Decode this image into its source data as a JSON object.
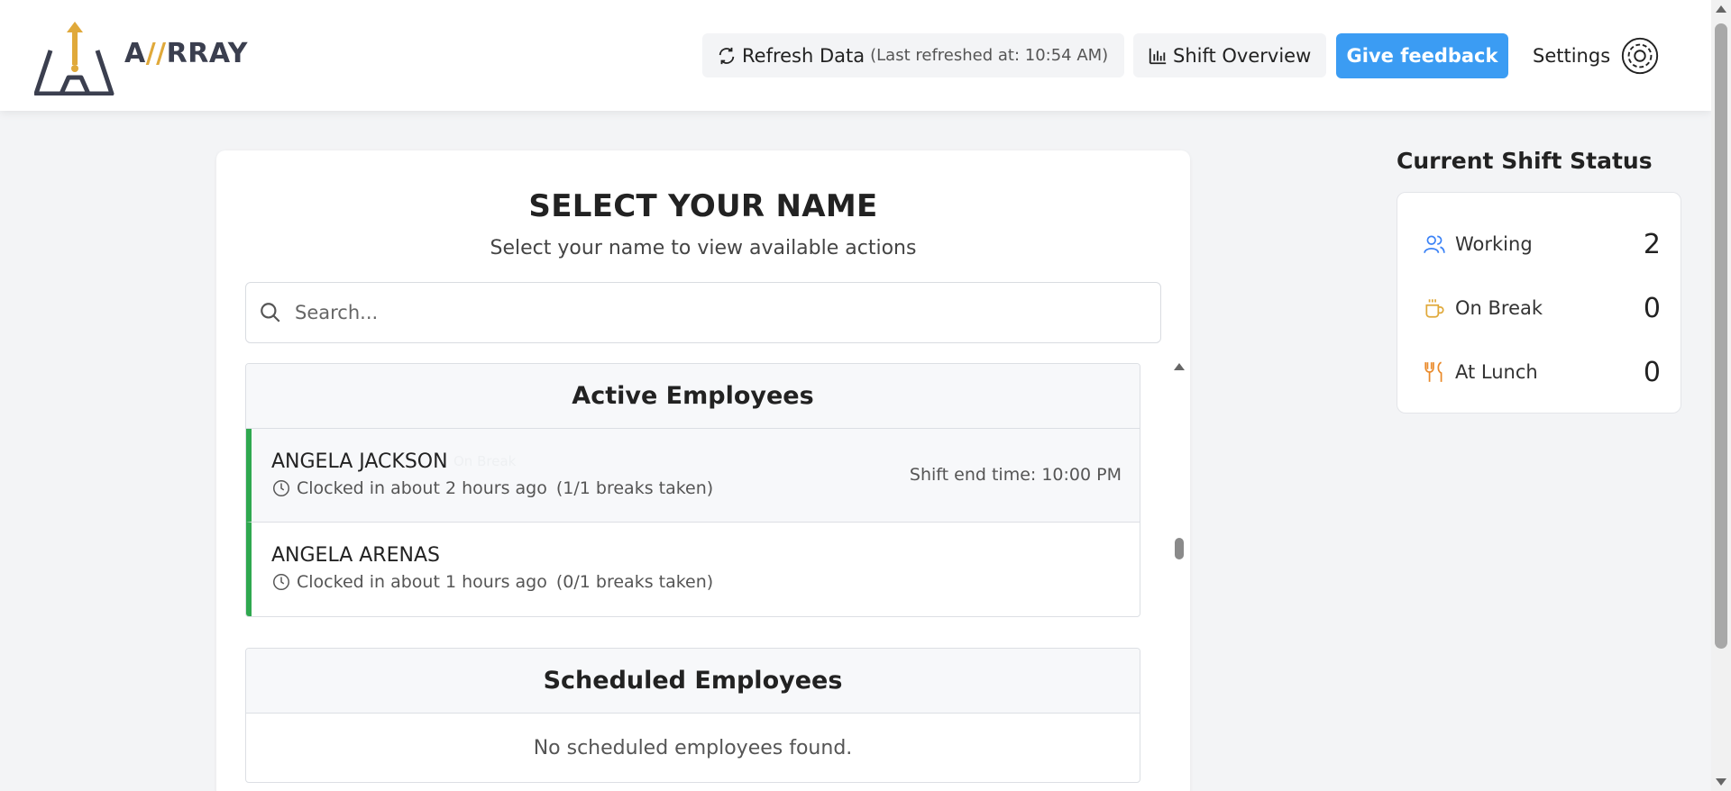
{
  "header": {
    "logo_text_a": "A",
    "logo_text_slash": "//",
    "logo_text_rest": "RRAY",
    "refresh_label": "Refresh Data",
    "refresh_sub": "(Last refreshed at: 10:54 AM)",
    "shift_overview_label": "Shift Overview",
    "feedback_label": "Give feedback",
    "settings_label": "Settings"
  },
  "main": {
    "title": "SELECT YOUR NAME",
    "subtitle": "Select your name to view available actions",
    "search_placeholder": "Search...",
    "active_section_title": "Active Employees",
    "active_employees": [
      {
        "name": "ANGELA JACKSON",
        "badge": "On Break",
        "clocked": "Clocked in about 2 hours ago",
        "breaks": "(1/1 breaks taken)",
        "shift_end": "Shift end time: 10:00 PM"
      },
      {
        "name": "ANGELA ARENAS",
        "clocked": "Clocked in about 1 hours ago",
        "breaks": "(0/1 breaks taken)"
      }
    ],
    "scheduled_section_title": "Scheduled Employees",
    "scheduled_empty": "No scheduled employees found."
  },
  "status": {
    "title": "Current Shift Status",
    "items": [
      {
        "label": "Working",
        "value": "2",
        "icon": "users-icon",
        "color": "#3b82f6"
      },
      {
        "label": "On Break",
        "value": "0",
        "icon": "coffee-icon",
        "color": "#e0a93a"
      },
      {
        "label": "At Lunch",
        "value": "0",
        "icon": "utensils-icon",
        "color": "#ea8a2a"
      }
    ]
  },
  "colors": {
    "accent": "#3b9cf3",
    "active_border": "#2fa84f",
    "logo_gold": "#e0a93a",
    "logo_dark": "#3b3f4f"
  }
}
